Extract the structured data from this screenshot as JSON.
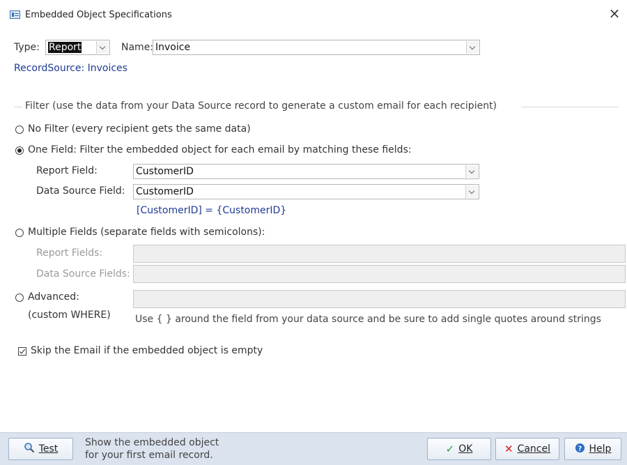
{
  "window": {
    "title": "Embedded Object Specifications",
    "close_glyph": "×"
  },
  "top": {
    "type_label": "Type:",
    "type_value": "Report",
    "name_label": "Name:",
    "name_value": "Invoice",
    "recordsource": "RecordSource: Invoices"
  },
  "filter": {
    "group_label": "Filter (use the data from your Data Source record to generate a custom email for each recipient)",
    "no_filter_label": "No Filter (every recipient gets the same data)",
    "one_field_label": "One Field: Filter the embedded object for each email by matching these fields:",
    "report_field_label": "Report Field:",
    "report_field_value": "CustomerID",
    "data_source_field_label": "Data Source Field:",
    "data_source_field_value": "CustomerID",
    "expression": "[CustomerID] = {CustomerID}",
    "multiple_fields_label": "Multiple Fields (separate fields with semicolons):",
    "report_fields_label": "Report Fields:",
    "data_source_fields_label": "Data Source Fields:",
    "advanced_label": "Advanced:",
    "advanced_sub": "(custom WHERE)",
    "advanced_hint": "Use { } around the field from your data source and be sure to add single quotes around strings",
    "selected_option": "one_field"
  },
  "skip_empty": {
    "label": "Skip the Email if the embedded object is empty",
    "checked": true
  },
  "footer": {
    "test_label": "Test",
    "test_note_line1": "Show the embedded object",
    "test_note_line2": "for your first email record.",
    "ok_label": "OK",
    "cancel_label": "Cancel",
    "help_label": "Help"
  },
  "icons": {
    "title": "form-icon",
    "test": "magnifier-icon",
    "ok": "checkmark-icon",
    "cancel": "x-icon",
    "help": "help-circle-icon"
  },
  "colors": {
    "link_blue": "#1f3a93",
    "footer_bg": "#dbe3ee",
    "cancel_red": "#d42020",
    "ok_green": "#2e9b3a",
    "help_blue": "#2f6fc4"
  }
}
